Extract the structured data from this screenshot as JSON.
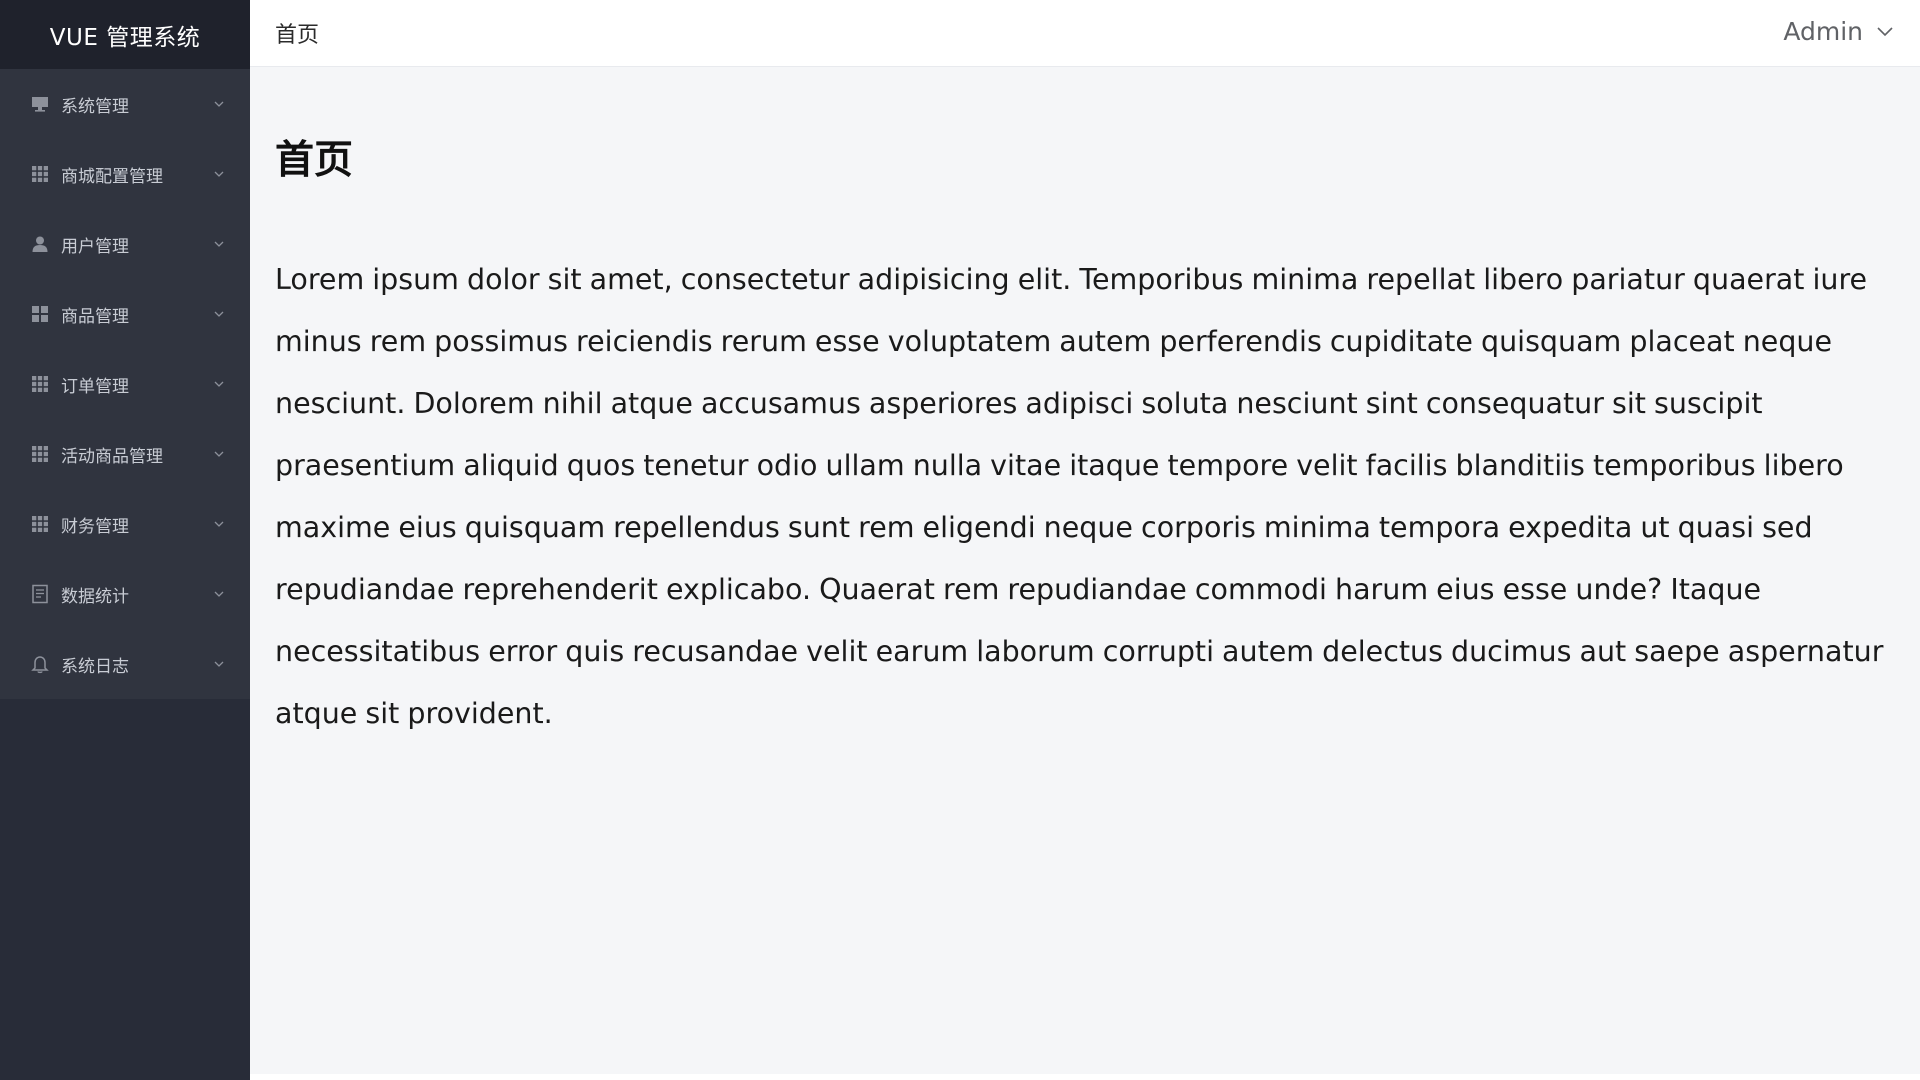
{
  "app": {
    "title": "VUE 管理系统"
  },
  "sidebar": {
    "items": [
      {
        "label": "系统管理",
        "icon": "monitor-icon"
      },
      {
        "label": "商城配置管理",
        "icon": "grid-icon"
      },
      {
        "label": "用户管理",
        "icon": "user-icon"
      },
      {
        "label": "商品管理",
        "icon": "grid-four-icon"
      },
      {
        "label": "订单管理",
        "icon": "grid-icon"
      },
      {
        "label": "活动商品管理",
        "icon": "grid-icon"
      },
      {
        "label": "财务管理",
        "icon": "grid-icon"
      },
      {
        "label": "数据统计",
        "icon": "document-icon"
      },
      {
        "label": "系统日志",
        "icon": "bell-icon"
      }
    ]
  },
  "header": {
    "breadcrumb": "首页",
    "user_name": "Admin"
  },
  "main": {
    "title": "首页",
    "paragraph": "Lorem ipsum dolor sit amet, consectetur adipisicing elit. Temporibus minima repellat libero pariatur quaerat iure minus rem possimus reiciendis rerum esse voluptatem autem perferendis cupiditate quisquam placeat neque nesciunt. Dolorem nihil atque accusamus asperiores adipisci soluta nesciunt sint consequatur sit suscipit praesentium aliquid quos tenetur odio ullam nulla vitae itaque tempore velit facilis blanditiis temporibus libero maxime eius quisquam repellendus sunt rem eligendi neque corporis minima tempora expedita ut quasi sed repudiandae reprehenderit explicabo. Quaerat rem repudiandae commodi harum eius esse unde? Itaque necessitatibus error quis recusandae velit earum laborum corrupti autem delectus ducimus aut saepe aspernatur atque sit provident."
  },
  "colors": {
    "sidebar_bg": "#282c38",
    "menu_bg": "#30343f",
    "logo_bg": "#1f222c",
    "content_bg": "#f5f6f8"
  }
}
